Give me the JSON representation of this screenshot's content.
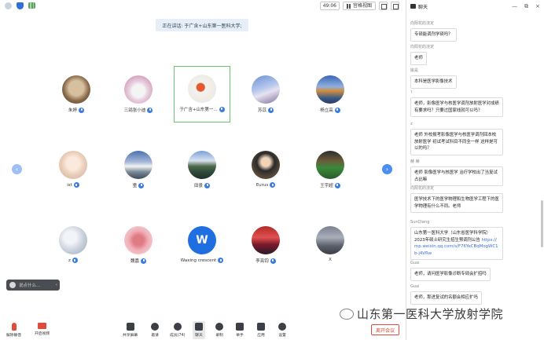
{
  "topbar": {
    "timer": "49:06",
    "view_label": "宫格视图"
  },
  "speaking_banner": "正在讲话: 于广含+山东第一医科大学;",
  "participants": [
    {
      "name": "朱婷",
      "avatar": "cat-photo"
    },
    {
      "name": "三鸽张小迪",
      "avatar": "cat-cartoon"
    },
    {
      "name": "于广含+山东第一...",
      "avatar": "koi-fish",
      "active": true
    },
    {
      "name": "苏苡",
      "avatar": "landscape-blue"
    },
    {
      "name": "杨立高",
      "avatar": "autumn-lake"
    },
    {
      "name": "ist",
      "avatar": "cartoon-girl"
    },
    {
      "name": "童",
      "avatar": "snow-mountain"
    },
    {
      "name": "田景",
      "avatar": "mountain-lake"
    },
    {
      "name": "Eurus",
      "avatar": "anime-figure"
    },
    {
      "name": "王宇超",
      "avatar": "family-photo"
    },
    {
      "name": "z",
      "avatar": "cloudy-sky"
    },
    {
      "name": "魏嘉",
      "avatar": "pink-flowers"
    },
    {
      "name": "Waxing crescent",
      "avatar": "letter-w",
      "letter": "W"
    },
    {
      "name": "李亮钧",
      "avatar": "red-sky"
    },
    {
      "name": "X",
      "avatar": "dark-sky"
    }
  ],
  "chat_float_placeholder": "说点什么...",
  "toolbar": {
    "items": [
      {
        "label": "解除静音",
        "icon": "mic-off-icon"
      },
      {
        "label": "开启视频",
        "icon": "camera-off-icon"
      },
      {
        "label": "共享屏幕",
        "icon": "share-screen-icon"
      },
      {
        "label": "邀请",
        "icon": "invite-icon"
      },
      {
        "label": "成员(74)",
        "icon": "members-icon"
      },
      {
        "label": "聊天",
        "icon": "chat-icon"
      },
      {
        "label": "录制",
        "icon": "record-icon"
      },
      {
        "label": "举手",
        "icon": "raise-hand-icon"
      },
      {
        "label": "应用",
        "icon": "apps-icon"
      },
      {
        "label": "设置",
        "icon": "settings-icon"
      }
    ],
    "leave_label": "离开会议"
  },
  "chat_panel": {
    "title": "聊天",
    "messages": [
      {
        "sender": "向阳花的浇定",
        "text": "专硕能调剂学硕吗？"
      },
      {
        "sender": "向阳花的浇定",
        "text": "老师"
      },
      {
        "sender": "姚是",
        "text": "本科是医学影像技术"
      },
      {
        "sender": "?",
        "text": "老师，影像医学与核医学调剂放射医学对成绩有要求吗？只要过国家线就可以吗？"
      },
      {
        "sender": "z",
        "text": "老师 外校报考影像医学与核医学调剂回本校放射医学 初试考试科目不同全一样 这样是可以的吗？"
      },
      {
        "sender": "赫 赫",
        "text": "老师 影像医学与核医学 治疗学校出了当复试占比嘛"
      },
      {
        "sender": "向阳花的浇定",
        "text": "医学技术下的医学物理和生物医学工程下的医学物理有什么不同。老师"
      },
      {
        "sender": "SunQiang",
        "text": "山东第一医科大学（山东省医学科学院）2023年硕士研究生招生预调剂公告",
        "link": "https://mp.weixin.qq.com/s/F76YeCBqMogWC1b-j4VRw"
      },
      {
        "sender": "Guai",
        "text": "老师，请问医学影像诊断专硕会扩招吗"
      },
      {
        "sender": "Guai",
        "text": "老师，那进复试的名额会相应扩吗"
      }
    ]
  },
  "watermark": "山东第一医科大学放射学院",
  "colors": {
    "accent_blue": "#3a7be0",
    "active_border": "#6cc36c",
    "leave_red": "#e24b3b"
  }
}
